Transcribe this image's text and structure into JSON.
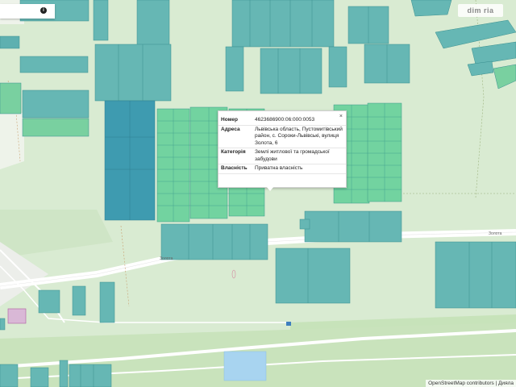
{
  "map": {
    "logo_text": "dim ria",
    "attribution": "OpenStreetMap contributors | Дияла",
    "road_labels": [
      "Золота",
      "Золота"
    ]
  },
  "search": {
    "value": "",
    "info_icon": "info-icon"
  },
  "popup": {
    "rows": [
      {
        "label": "Номер",
        "value": "4623686900:06:000:0053"
      },
      {
        "label": "Адреса",
        "value": "Львівська область, Пустомитівський район, с. Сороки-Львівські, вулиця Золота, 6"
      },
      {
        "label": "Категорія",
        "value": "Землі житлової та громадської забудови"
      },
      {
        "label": "Власність",
        "value": "Приватна власність"
      }
    ],
    "close_label": "×"
  },
  "colors": {
    "background": "#d8ead0",
    "parcel_teal": "#5fb3b3",
    "parcel_dark": "#3f9aaa",
    "parcel_green": "#6fd3a0",
    "road": "#ffffff",
    "water": "#a8d4f0",
    "field": "#cfe6c4"
  }
}
